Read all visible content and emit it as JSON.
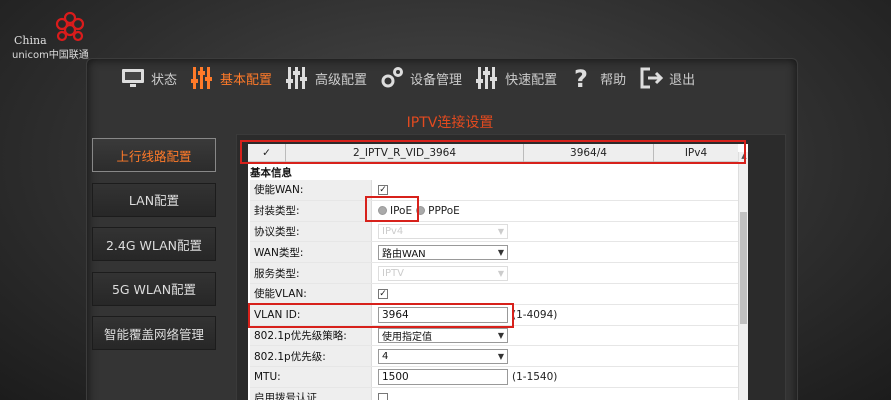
{
  "brand": {
    "line1": "China",
    "line2": "unicom中国联通"
  },
  "nav": [
    {
      "label": "状态",
      "icon": "monitor-icon",
      "active": false
    },
    {
      "label": "基本配置",
      "icon": "sliders-icon",
      "active": true
    },
    {
      "label": "高级配置",
      "icon": "sliders-icon",
      "active": false
    },
    {
      "label": "设备管理",
      "icon": "gears-icon",
      "active": false
    },
    {
      "label": "快速配置",
      "icon": "sliders-icon",
      "active": false
    },
    {
      "label": "帮助",
      "icon": "question-icon",
      "active": false
    },
    {
      "label": "退出",
      "icon": "exit-icon",
      "active": false
    }
  ],
  "page_title": "IPTV连接设置",
  "sidebar": [
    {
      "label": "上行线路配置",
      "active": true
    },
    {
      "label": "LAN配置"
    },
    {
      "label": "2.4G WLAN配置"
    },
    {
      "label": "5G WLAN配置"
    },
    {
      "label": "智能覆盖网络管理"
    }
  ],
  "connection": {
    "check": "✓",
    "name": "2_IPTV_R_VID_3964",
    "vlan": "3964/4",
    "proto": "IPv4"
  },
  "section_title": "基本信息",
  "form": {
    "enable_wan": {
      "label": "使能WAN:",
      "checked": "✓"
    },
    "encap": {
      "label": "封装类型:",
      "opt1": "IPoE",
      "opt2": "PPPoE"
    },
    "protocol": {
      "label": "协议类型:",
      "value": "IPv4"
    },
    "wan_type": {
      "label": "WAN类型:",
      "value": "路由WAN"
    },
    "service_type": {
      "label": "服务类型:",
      "value": "IPTV"
    },
    "enable_vlan": {
      "label": "使能VLAN:",
      "checked": "✓"
    },
    "vlan_id": {
      "label": "VLAN ID:",
      "value": "3964",
      "hint": "(1-4094)"
    },
    "p8021_policy": {
      "label": "802.1p优先级策略:",
      "value": "使用指定值"
    },
    "p8021_prio": {
      "label": "802.1p优先级:",
      "value": "4"
    },
    "mtu": {
      "label": "MTU:",
      "value": "1500",
      "hint": "(1-1540)"
    },
    "auth": {
      "label": "启用拨号认证",
      "checked": ""
    }
  },
  "colors": {
    "accent": "#ff7a29",
    "highlight": "#d7211b",
    "title": "#e34a1f"
  }
}
